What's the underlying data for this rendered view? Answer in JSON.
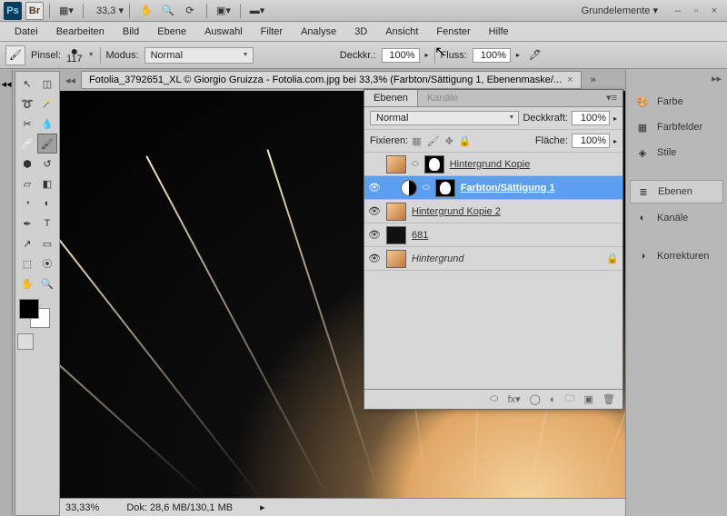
{
  "titlebar": {
    "zoom": "33,3 ▾",
    "workspace": "Grundelemente ▾"
  },
  "menu": {
    "items": [
      "Datei",
      "Bearbeiten",
      "Bild",
      "Ebene",
      "Auswahl",
      "Filter",
      "Analyse",
      "3D",
      "Ansicht",
      "Fenster",
      "Hilfe"
    ]
  },
  "options": {
    "brush_label": "Pinsel:",
    "brush_size": "117",
    "mode_label": "Modus:",
    "mode_value": "Normal",
    "opacity_label": "Deckkr.:",
    "opacity_value": "100%",
    "flow_label": "Fluss:",
    "flow_value": "100%"
  },
  "doc": {
    "tab_title": "Fotolia_3792651_XL © Giorgio Gruizza - Fotolia.com.jpg bei 33,3% (Farbton/Sättigung 1, Ebenenmaske/..."
  },
  "status": {
    "zoom": "33,33%",
    "doc": "Dok: 28,6 MB/130,1 MB"
  },
  "layers_panel": {
    "tabs": {
      "layers": "Ebenen",
      "channels": "Kanäle"
    },
    "blend_mode": "Normal",
    "opacity_label": "Deckkraft:",
    "opacity_value": "100%",
    "lock_label": "Fixieren:",
    "fill_label": "Fläche:",
    "fill_value": "100%",
    "layers": [
      {
        "name": "Hintergrund Kopie",
        "visible": false,
        "has_mask": true,
        "selected": false,
        "italic": false,
        "linked": true
      },
      {
        "name": "Farbton/Sättigung 1",
        "visible": true,
        "has_mask": true,
        "selected": true,
        "italic": false,
        "adjustment": true
      },
      {
        "name": "Hintergrund Kopie 2",
        "visible": true,
        "has_mask": false,
        "selected": false,
        "italic": false
      },
      {
        "name": "681",
        "visible": true,
        "has_mask": false,
        "selected": false,
        "italic": false,
        "dark": true
      },
      {
        "name": "Hintergrund",
        "visible": true,
        "has_mask": false,
        "selected": false,
        "italic": true,
        "locked": true
      }
    ]
  },
  "dock": {
    "color": "Farbe",
    "swatches": "Farbfelder",
    "styles": "Stile",
    "layers": "Ebenen",
    "channels": "Kanäle",
    "adjustments": "Korrekturen"
  }
}
